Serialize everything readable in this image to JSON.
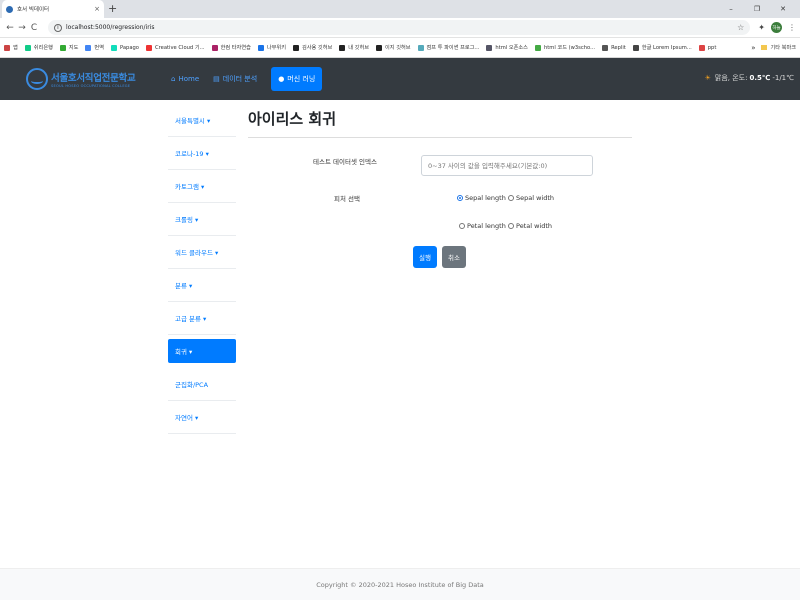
{
  "browser": {
    "tab_title": "호서 빅데이터",
    "tab_close": "×",
    "new_tab": "+",
    "window_controls": [
      "–",
      "❐",
      "✕"
    ],
    "nav": {
      "back": "←",
      "forward": "→",
      "reload": "C"
    },
    "url": "localhost:5000/regression/iris",
    "star": "☆",
    "avatar": "하늘",
    "menu": "⋮",
    "bookmarks": [
      {
        "label": "앱",
        "color": "#c44"
      },
      {
        "label": "쉬리은행",
        "color": "#1c8"
      },
      {
        "label": "지도",
        "color": "#3a3"
      },
      {
        "label": "번역",
        "color": "#4285f4"
      },
      {
        "label": "Papago",
        "color": "#1db"
      },
      {
        "label": "Creative Cloud 기...",
        "color": "#e33"
      },
      {
        "label": "한컴 타자연습",
        "color": "#a26"
      },
      {
        "label": "나무위키",
        "color": "#1a73e8"
      },
      {
        "label": "김사용 깃허브",
        "color": "#222"
      },
      {
        "label": "내 깃허브",
        "color": "#222"
      },
      {
        "label": "이지 깃허브",
        "color": "#222"
      },
      {
        "label": "점프 투 파이썬 프로그...",
        "color": "#5ab"
      },
      {
        "label": "html 오픈소스",
        "color": "#556"
      },
      {
        "label": "html 코드 (w3scho...",
        "color": "#4a4"
      },
      {
        "label": "Replit",
        "color": "#555"
      },
      {
        "label": "한글 Lorem Ipsum...",
        "color": "#444"
      },
      {
        "label": "ppt",
        "color": "#d44"
      }
    ],
    "bookmarks_more": "»",
    "bookmarks_other": "기타 북마크"
  },
  "navbar": {
    "logo_kr": "서울호서직업전문학교",
    "logo_en": "SEOUL HOSEO OCCUPATIONAL COLLEGE",
    "items": [
      {
        "label": "Home",
        "icon": "home-icon",
        "glyph": "⌂"
      },
      {
        "label": "데이터 분석",
        "icon": "chart-icon",
        "glyph": "▤"
      },
      {
        "label": "머신 러닝",
        "icon": "brain-icon",
        "glyph": "●"
      }
    ],
    "weather_prefix": "맑음, 온도:",
    "weather_temp": "0.5℃",
    "weather_suffix": "-1/1℃",
    "weather_icon": "☀"
  },
  "sidebar": {
    "items": [
      {
        "label": "서울특별시 ▾"
      },
      {
        "label": "코로나-19 ▾"
      },
      {
        "label": "카토그램 ▾"
      },
      {
        "label": "크롤링 ▾"
      },
      {
        "label": "워드 클라우드 ▾"
      },
      {
        "label": "분류 ▾"
      },
      {
        "label": "고급 분류 ▾"
      },
      {
        "label": "회귀 ▾",
        "active": true
      },
      {
        "label": "군집화/PCA"
      },
      {
        "label": "자연어 ▾"
      }
    ]
  },
  "main": {
    "title": "아이리스 회귀",
    "index_label": "테스트 데이터셋 인덱스",
    "index_placeholder": "0~37 사이의 값을 입력해주세요(기본값:0)",
    "feature_label": "피처 선택",
    "features": [
      {
        "label": "Sepal length",
        "checked": true
      },
      {
        "label": "Sepal width",
        "checked": false
      },
      {
        "label": "Petal length",
        "checked": false
      },
      {
        "label": "Petal width",
        "checked": false
      }
    ],
    "run_label": "실행",
    "cancel_label": "취소"
  },
  "footer": {
    "copyright": "Copyright © 2020-2021 Hoseo Institute of Big Data"
  }
}
